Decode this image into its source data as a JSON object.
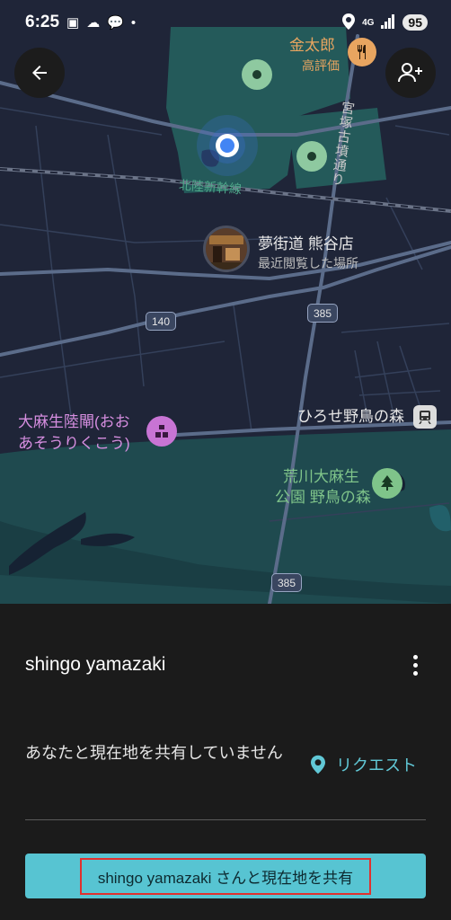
{
  "status_bar": {
    "time": "6:25",
    "network": "4G",
    "battery": "95"
  },
  "map": {
    "places": {
      "restaurant_name": "金太郎",
      "restaurant_sub": "高評価",
      "shop_name": "夢街道 熊谷店",
      "shop_sub": "最近閲覧した場所",
      "gate_name_line1": "大麻生陸閘(おお",
      "gate_name_line2": "あそうりくこう)",
      "park_line1": "荒川大麻生",
      "park_line2": "公園 野鳥の森",
      "bus_stop": "ひろせ野鳥の森"
    },
    "roads": {
      "shinkansen": "北陸新幹線",
      "street": "宮塚古墳通り",
      "route_140": "140",
      "route_385_a": "385",
      "route_385_b": "385"
    },
    "colors": {
      "land": "#1f2538",
      "park": "#245a5a",
      "water": "#1f4a4f",
      "road": "#5b6c8a",
      "location_dot": "#4285f4"
    }
  },
  "sheet": {
    "person_name": "shingo yamazaki",
    "status_message": "あなたと現在地を共有していません",
    "request_label": "リクエスト",
    "share_button_label": "shingo yamazaki さんと現在地を共有"
  }
}
